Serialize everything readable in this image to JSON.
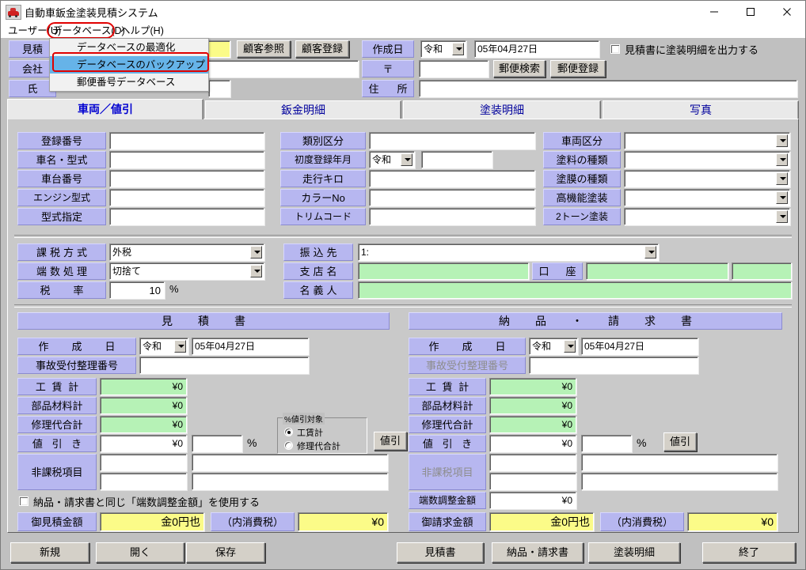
{
  "window": {
    "title": "自動車鈑金塗装見積システム",
    "icon": "car-icon",
    "minimize": "minimize-icon",
    "maximize": "maximize-icon",
    "close": "close-icon"
  },
  "menubar": {
    "items": [
      {
        "label": "ユーザー(U)"
      },
      {
        "label": "データベース(D)"
      },
      {
        "label": "ヘルプ(H)"
      }
    ],
    "open_menu": "データベース(D)",
    "highlight_color": "#e00000"
  },
  "dropdown": {
    "items": [
      {
        "label": "データベースの最適化",
        "selected": false
      },
      {
        "label": "データベースのバックアップ",
        "selected": true
      },
      {
        "label": "郵便番号データベース",
        "selected": false
      }
    ],
    "selected_color": "#66b3e8"
  },
  "header": {
    "estimate_no_label": "見積",
    "company_label": "会社",
    "name_label": "氏",
    "estimate_no_value": "",
    "customer_ref_button": "顧客参照",
    "customer_reg_button": "顧客登録",
    "create_date_label": "作成日",
    "era": "令和",
    "create_date": "05年04月27日",
    "postal_label": "〒",
    "postal_value": "",
    "postal_search_button": "郵便検索",
    "postal_reg_button": "郵便登録",
    "address_label": "住　所",
    "address_value": "",
    "print_paint_detail_check": "見積書に塗装明細を出力する",
    "print_paint_detail_checked": false
  },
  "tabs": [
    {
      "label": "車両／値引",
      "active": true
    },
    {
      "label": "鈑金明細",
      "active": false
    },
    {
      "label": "塗装明細",
      "active": false
    },
    {
      "label": "写真",
      "active": false
    }
  ],
  "vehicle": {
    "col1": [
      {
        "label": "登録番号",
        "value": ""
      },
      {
        "label": "車名・型式",
        "value": ""
      },
      {
        "label": "車台番号",
        "value": ""
      },
      {
        "label": "エンジン型式",
        "value": ""
      },
      {
        "label": "型式指定",
        "value": ""
      }
    ],
    "col2": [
      {
        "label": "類別区分",
        "value": "",
        "type": "text"
      },
      {
        "label": "初度登録年月",
        "value": "",
        "type": "era",
        "era": "令和"
      },
      {
        "label": "走行キロ",
        "value": "",
        "type": "text"
      },
      {
        "label": "カラーNo",
        "value": "",
        "type": "text"
      },
      {
        "label": "トリムコード",
        "value": "",
        "type": "text"
      }
    ],
    "col3": [
      {
        "label": "車両区分",
        "value": ""
      },
      {
        "label": "塗料の種類",
        "value": ""
      },
      {
        "label": "塗膜の種類",
        "value": ""
      },
      {
        "label": "高機能塗装",
        "value": ""
      },
      {
        "label": "2トーン塗装",
        "value": ""
      }
    ]
  },
  "tax": {
    "method_label": "課税方式",
    "method_value": "外税",
    "rounding_label": "端数処理",
    "rounding_value": "切捨て",
    "rate_label": "税　率",
    "rate_value": "10",
    "rate_unit": "%"
  },
  "bank": {
    "transfer_label": "振込先",
    "transfer_value": "1:",
    "branch_label": "支店名",
    "branch_value": "",
    "account_label": "口　座",
    "account_type_value": "",
    "account_no_value": "",
    "holder_label": "名義人",
    "holder_value": ""
  },
  "estimate": {
    "section_title": "見　積　書",
    "create_date_label": "作　成　日",
    "era": "令和",
    "create_date": "05年04月27日",
    "accident_no_label": "事故受付整理番号",
    "accident_no_value": "",
    "labor_label": "工 賃 計",
    "labor_value": "¥0",
    "parts_label": "部品材料計",
    "parts_value": "¥0",
    "repair_label": "修理代合計",
    "repair_value": "¥0",
    "discount_label": "値 引 き",
    "discount_value": "¥0",
    "discount_pct_value": "",
    "pct_unit": "%",
    "discount_button": "値引",
    "nontax_label": "非課税項目",
    "nontax_1a": "",
    "nontax_1b": "",
    "nontax_2a": "",
    "nontax_2b": "",
    "same_adjust_check": "納品・請求書と同じ「端数調整金額」を使用する",
    "same_adjust_checked": false,
    "total_label": "御見積金額",
    "total_value": "金0円也",
    "tax_incl_label": "（内消費税）",
    "tax_incl_value": "¥0",
    "discount_group_title": "%値引対象",
    "discount_radio": [
      {
        "label": "工賃計",
        "selected": true
      },
      {
        "label": "修理代合計",
        "selected": false
      }
    ]
  },
  "invoice": {
    "section_title": "納　品　・　請　求　書",
    "create_date_label": "作　成　日",
    "era": "令和",
    "create_date": "05年04月27日",
    "accident_no_label": "事故受付整理番号",
    "accident_no_value": "",
    "labor_label": "工 賃 計",
    "labor_value": "¥0",
    "parts_label": "部品材料計",
    "parts_value": "¥0",
    "repair_label": "修理代合計",
    "repair_value": "¥0",
    "discount_label": "値 引 き",
    "discount_value": "¥0",
    "discount_pct_value": "",
    "pct_unit": "%",
    "discount_button": "値引",
    "nontax_label": "非課税項目",
    "nontax_1a": "",
    "nontax_1b": "",
    "nontax_2a": "",
    "nontax_2b": "",
    "adjust_label": "端数調整金額",
    "adjust_value": "¥0",
    "total_label": "御請求金額",
    "total_value": "金0円也",
    "tax_incl_label": "（内消費税）",
    "tax_incl_value": "¥0"
  },
  "footer": {
    "new_button": "新規",
    "open_button": "開く",
    "save_button": "保存",
    "estimate_button": "見積書",
    "invoice_button": "納品・請求書",
    "paint_button": "塗装明細",
    "exit_button": "終了"
  },
  "colors": {
    "label_bg": "#b7b7f0",
    "readonly_green": "#b6f2b6",
    "total_yellow": "#fbfb88",
    "surface": "#c0c0c0",
    "tab_text": "#0000d0"
  }
}
